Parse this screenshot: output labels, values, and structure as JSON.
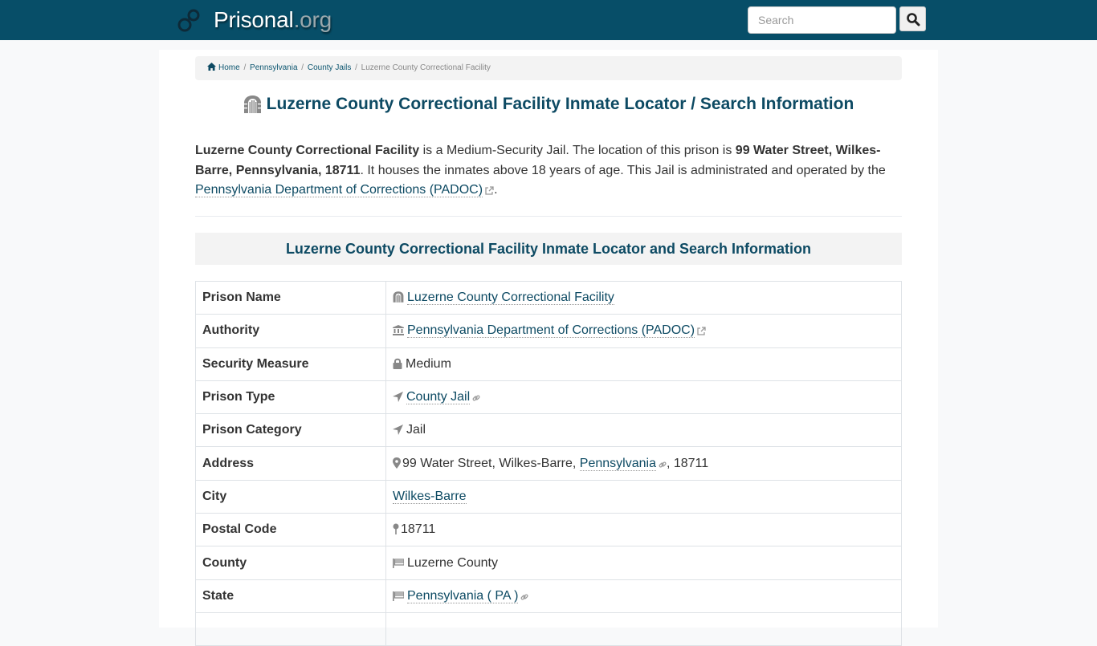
{
  "header": {
    "brand_main": "Prisonal",
    "brand_tld": ".org",
    "search_placeholder": "Search",
    "search_button_icon": "search-icon"
  },
  "breadcrumb": {
    "items": [
      {
        "label": "Home",
        "icon": "home-icon"
      },
      {
        "label": "Pennsylvania"
      },
      {
        "label": "County Jails"
      },
      {
        "label": "Luzerne County Correctional Facility"
      }
    ]
  },
  "page": {
    "title": "Luzerne County Correctional Facility Inmate Locator / Search Information",
    "title_icon": "prison-gate-icon"
  },
  "intro": {
    "facility_name": "Luzerne County Correctional Facility",
    "text1": " is a Medium-Security Jail. The location of this prison is ",
    "address_bold": "99 Water Street, Wilkes-Barre, Pennsylvania, 18711",
    "text2": ". It houses the inmates above 18 years of age. This Jail is administrated and operated by the ",
    "authority_link": "Pennsylvania Department of Corrections (PADOC)",
    "text3": "."
  },
  "section": {
    "heading": "Luzerne County Correctional Facility Inmate Locator and Search Information"
  },
  "table": {
    "rows": [
      {
        "label": "Prison Name",
        "icon": "prison-gate-icon",
        "value": "Luzerne County Correctional Facility",
        "link": true
      },
      {
        "label": "Authority",
        "icon": "institution-icon",
        "value": "Pennsylvania Department of Corrections (PADOC)",
        "link": true,
        "external": true
      },
      {
        "label": "Security Measure",
        "icon": "lock-icon",
        "value": "Medium"
      },
      {
        "label": "Prison Type",
        "icon": "location-arrow-icon",
        "value": "County Jail",
        "link": true,
        "chain": true
      },
      {
        "label": "Prison Category",
        "icon": "location-arrow-icon",
        "value": "Jail"
      },
      {
        "label": "Address",
        "icon": "map-marker-icon",
        "street": "99 Water Street, Wilkes-Barre, ",
        "state_link": "Pennsylvania",
        "zip": ", 18711"
      },
      {
        "label": "City",
        "value": "Wilkes-Barre",
        "link": true
      },
      {
        "label": "Postal Code",
        "icon": "map-pin-icon",
        "value": "18711"
      },
      {
        "label": "County",
        "icon": "flag-icon",
        "value": "Luzerne County"
      },
      {
        "label": "State",
        "icon": "flag-icon",
        "value": "Pennsylvania ( PA )",
        "link": true,
        "chain": true
      }
    ]
  }
}
